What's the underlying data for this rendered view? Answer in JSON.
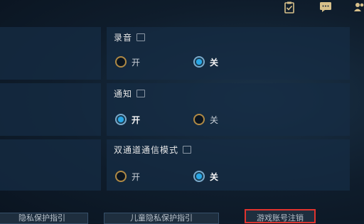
{
  "topbar": {
    "icons": [
      "clipboard-check-icon",
      "chat-icon",
      "friends-icon"
    ]
  },
  "settings": [
    {
      "title": "录音",
      "options": [
        {
          "label": "开",
          "selected": false
        },
        {
          "label": "关",
          "selected": true
        }
      ]
    },
    {
      "title": "通知",
      "options": [
        {
          "label": "开",
          "selected": true
        },
        {
          "label": "关",
          "selected": false
        }
      ]
    },
    {
      "title": "双通道通信模式",
      "options": [
        {
          "label": "开",
          "selected": false
        },
        {
          "label": "关",
          "selected": true
        }
      ]
    }
  ],
  "footer": {
    "buttons": [
      {
        "label": "隐私保护指引"
      },
      {
        "label": "儿童隐私保护指引"
      },
      {
        "label": "游戏账号注销",
        "highlighted": true
      }
    ]
  },
  "colors": {
    "accent_selected": "#2aa7e6",
    "radio_ring": "#b08a45",
    "highlight_box": "#e0332e"
  }
}
